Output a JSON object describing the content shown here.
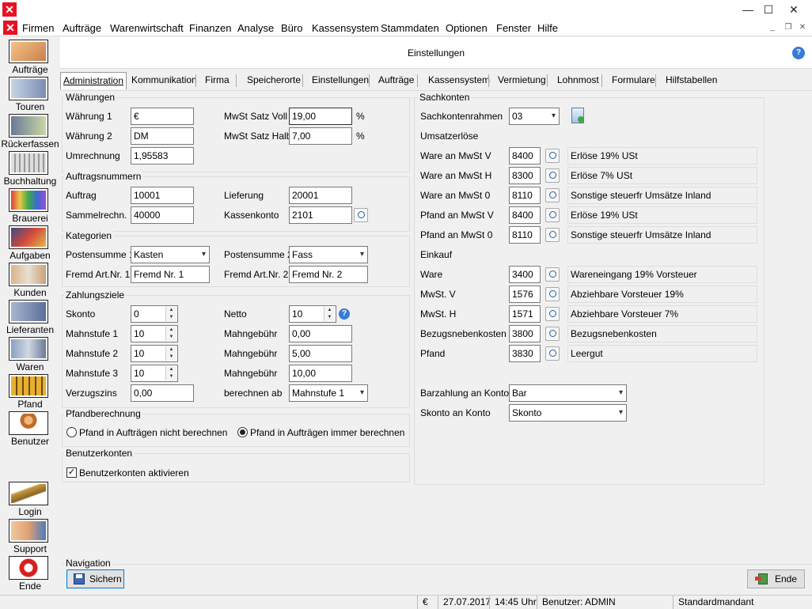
{
  "window": {
    "title": "Einstellungen",
    "minimize": "—",
    "maximize": "☐",
    "close": "✕",
    "app_icon": "x-logo-icon"
  },
  "menu": [
    "Firmen",
    "Aufträge",
    "Warenwirtschaft",
    "Finanzen",
    "Analyse",
    "Büro",
    "Kassensystem",
    "Stammdaten",
    "Optionen",
    "Fenster",
    "Hilfe"
  ],
  "mdi_controls": {
    "minimize": "_",
    "restore": "❐",
    "close": "✕"
  },
  "sidebar": [
    {
      "label": "Aufträge",
      "icon": "auftraege-icon"
    },
    {
      "label": "Touren",
      "icon": "truck-icon"
    },
    {
      "label": "Rückerfassen",
      "icon": "return-truck-icon"
    },
    {
      "label": "Buchhaltung",
      "icon": "ledger-icon"
    },
    {
      "label": "Brauerei",
      "icon": "brewery-icon"
    },
    {
      "label": "Aufgaben",
      "icon": "tasks-icon"
    },
    {
      "label": "Kunden",
      "icon": "customers-icon"
    },
    {
      "label": "Lieferanten",
      "icon": "suppliers-icon"
    },
    {
      "label": "Waren",
      "icon": "goods-icon"
    },
    {
      "label": "Pfand",
      "icon": "deposit-icon"
    },
    {
      "label": "Benutzer",
      "icon": "user-icon"
    },
    {
      "label": "Login",
      "icon": "key-icon"
    },
    {
      "label": "Support",
      "icon": "handshake-icon"
    },
    {
      "label": "Ende",
      "icon": "power-icon"
    }
  ],
  "header": {
    "title": "Einstellungen",
    "help": "?"
  },
  "tabs": [
    "Administration",
    "Kommunikation",
    "Firma",
    "Speicherorte",
    "Einstellungen",
    "Aufträge",
    "Kassensystem",
    "Vermietung",
    "Lohnmost",
    "Formulare",
    "Hilfstabellen"
  ],
  "tab_hotkeys": [
    "A",
    "K",
    "F",
    "S",
    "E",
    "A",
    "K",
    "V",
    "L",
    "F",
    "H"
  ],
  "waehrungen": {
    "title": "Währungen",
    "w1_label": "Währung 1",
    "w1": "€",
    "w2_label": "Währung 2",
    "w2": "DM",
    "umr_label": "Umrechnung",
    "umr": "1,95583",
    "voll_label": "MwSt Satz Voll",
    "voll": "19,00",
    "voll_unit": "%",
    "halb_label": "MwSt Satz Halb",
    "halb": "7,00",
    "halb_unit": "%"
  },
  "auftragsnummern": {
    "title": "Auftragsnummern",
    "auftrag_label": "Auftrag",
    "auftrag": "10001",
    "sammel_label": "Sammelrechn.",
    "sammel": "40000",
    "lief_label": "Lieferung",
    "lief": "20001",
    "kasse_label": "Kassenkonto",
    "kasse": "2101"
  },
  "kategorien": {
    "title": "Kategorien",
    "ps1_label": "Postensumme 1",
    "ps1": "Kasten",
    "ps2_label": "Postensumme 2",
    "ps2": "Fass",
    "fa1_label": "Fremd Art.Nr. 1",
    "fa1": "Fremd Nr. 1",
    "fa2_label": "Fremd Art.Nr. 2",
    "fa2": "Fremd Nr. 2"
  },
  "zahlungsziele": {
    "title": "Zahlungsziele",
    "skonto_label": "Skonto",
    "skonto": "0",
    "netto_label": "Netto",
    "netto": "10",
    "m1_label": "Mahnstufe 1",
    "m1": "10",
    "m2_label": "Mahnstufe 2",
    "m2": "10",
    "m3_label": "Mahnstufe 3",
    "m3": "10",
    "g1_label": "Mahngebühr",
    "g1": "0,00",
    "g2_label": "Mahngebühr",
    "g2": "5,00",
    "g3_label": "Mahngebühr",
    "g3": "10,00",
    "vz_label": "Verzugszins",
    "vz": "0,00",
    "ab_label": "berechnen ab",
    "ab": "Mahnstufe 1"
  },
  "pfand": {
    "title": "Pfandberechnung",
    "opt1": "Pfand in Aufträgen nicht berechnen",
    "opt2": "Pfand in Aufträgen immer berechnen",
    "selected": 2
  },
  "benutzerkonten": {
    "title": "Benutzerkonten",
    "check_label": "Benutzerkonten aktivieren",
    "checked": true,
    "checkmark": "✓"
  },
  "sachkonten": {
    "title": "Sachkonten",
    "rahmen_label": "Sachkontenrahmen",
    "rahmen": "03",
    "umsatz_title": "Umsatzerlöse",
    "einkauf_title": "Einkauf",
    "umsatz": [
      {
        "label": "Ware an MwSt V",
        "konto": "8400",
        "desc": "Erlöse 19% USt"
      },
      {
        "label": "Ware an MwSt H",
        "konto": "8300",
        "desc": "Erlöse 7% USt"
      },
      {
        "label": "Ware an MwSt 0",
        "konto": "8110",
        "desc": "Sonstige steuerfr Umsätze Inland"
      },
      {
        "label": "Pfand an MwSt V",
        "konto": "8400",
        "desc": "Erlöse 19% USt"
      },
      {
        "label": "Pfand an MwSt 0",
        "konto": "8110",
        "desc": "Sonstige steuerfr Umsätze Inland"
      }
    ],
    "einkauf": [
      {
        "label": "Ware",
        "konto": "3400",
        "desc": "Wareneingang 19% Vorsteuer"
      },
      {
        "label": "MwSt. V",
        "konto": "1576",
        "desc": "Abziehbare Vorsteuer 19%"
      },
      {
        "label": "MwSt. H",
        "konto": "1571",
        "desc": "Abziehbare Vorsteuer 7%"
      },
      {
        "label": "Bezugsnebenkosten",
        "konto": "3800",
        "desc": "Bezugsnebenkosten"
      },
      {
        "label": "Pfand",
        "konto": "3830",
        "desc": "Leergut"
      }
    ],
    "bar_label": "Barzahlung an Konto",
    "bar": "Bar",
    "skonto_label": "Skonto an Konto",
    "skonto": "Skonto"
  },
  "navigation": {
    "title": "Navigation",
    "save": "Sichern",
    "end": "Ende"
  },
  "status": {
    "currency": "€",
    "date": "27.07.2017",
    "time": "14:45 Uhr",
    "user": "Benutzer: ADMIN",
    "mandant": "Standardmandant"
  }
}
